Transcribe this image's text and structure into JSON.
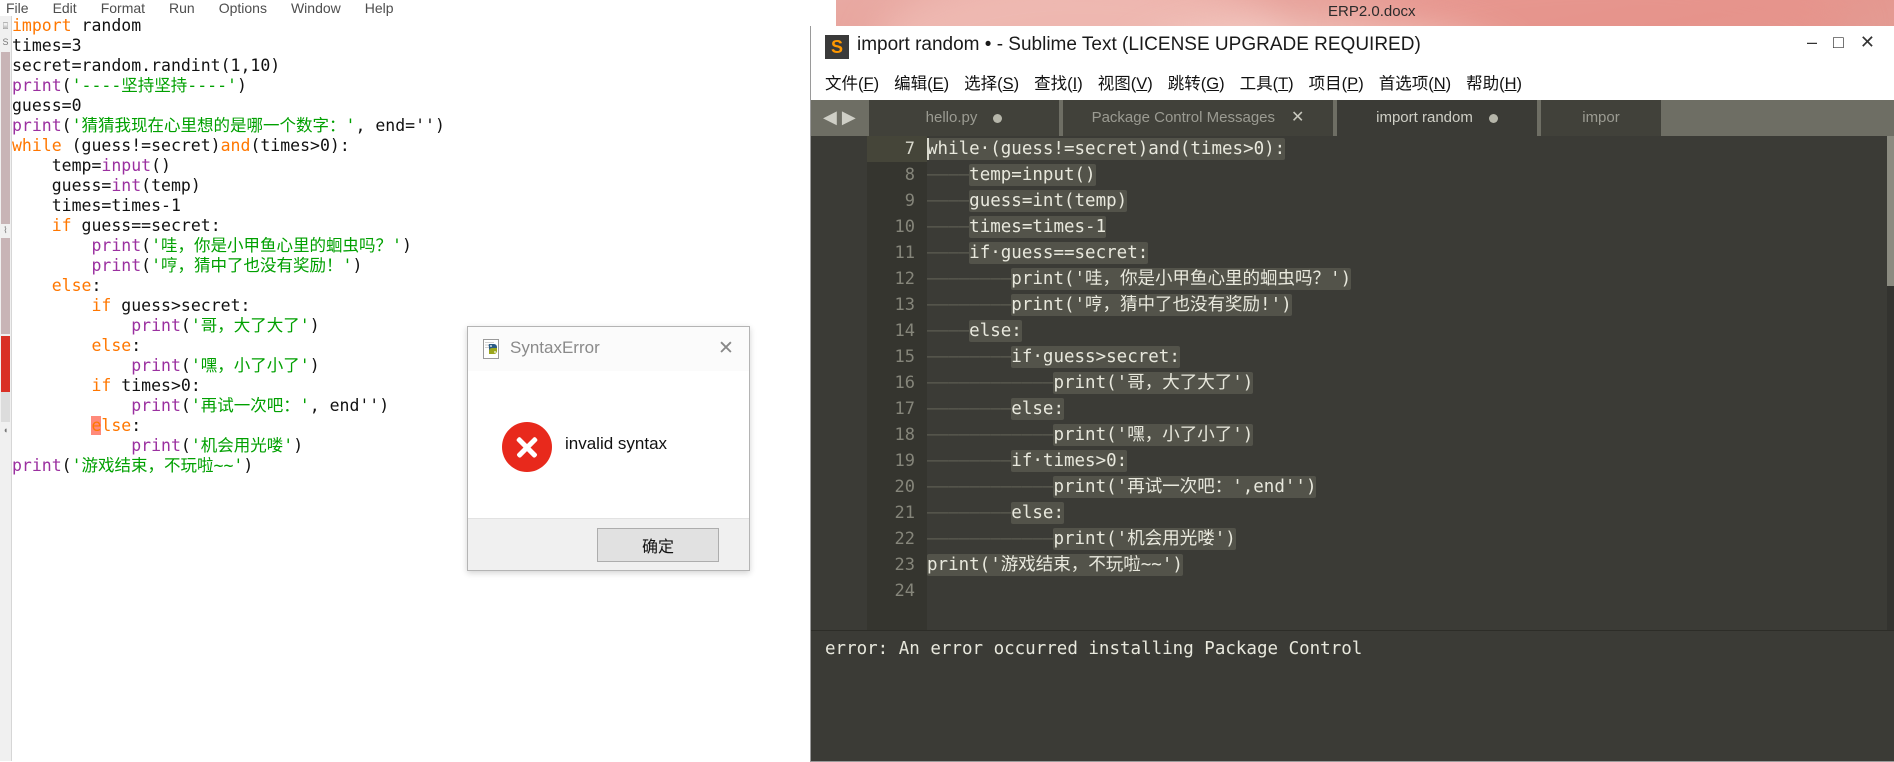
{
  "desktop": {
    "docx_label": "ERP2.0.docx"
  },
  "idle": {
    "window_name": "Python IDLE editor",
    "menubar": [
      "File",
      "Edit",
      "Format",
      "Run",
      "Options",
      "Window",
      "Help"
    ],
    "code_lines": [
      [
        {
          "t": "import ",
          "c": "kw"
        },
        {
          "t": "random",
          "c": ""
        }
      ],
      [
        {
          "t": "times=3",
          "c": ""
        }
      ],
      [
        {
          "t": "secret=random.randint(1,10)",
          "c": ""
        }
      ],
      [
        {
          "t": "print",
          "c": "fn"
        },
        {
          "t": "(",
          "c": ""
        },
        {
          "t": "'----坚持坚持----'",
          "c": "str"
        },
        {
          "t": ")",
          "c": ""
        }
      ],
      [
        {
          "t": "guess=0",
          "c": ""
        }
      ],
      [
        {
          "t": "print",
          "c": "fn"
        },
        {
          "t": "(",
          "c": ""
        },
        {
          "t": "'猜猜我现在心里想的是哪一个数字：'",
          "c": "str"
        },
        {
          "t": ", end='')",
          "c": ""
        }
      ],
      [
        {
          "t": "while",
          "c": "kw"
        },
        {
          "t": " (guess!=secret)",
          "c": ""
        },
        {
          "t": "and",
          "c": "kw"
        },
        {
          "t": "(times>0):",
          "c": ""
        }
      ],
      [
        {
          "t": "    temp=",
          "c": ""
        },
        {
          "t": "input",
          "c": "bi"
        },
        {
          "t": "()",
          "c": ""
        }
      ],
      [
        {
          "t": "    guess=",
          "c": ""
        },
        {
          "t": "int",
          "c": "bi"
        },
        {
          "t": "(temp)",
          "c": ""
        }
      ],
      [
        {
          "t": "    times=times-1",
          "c": ""
        }
      ],
      [
        {
          "t": "    ",
          "c": ""
        },
        {
          "t": "if",
          "c": "kw"
        },
        {
          "t": " guess==secret:",
          "c": ""
        }
      ],
      [
        {
          "t": "        ",
          "c": ""
        },
        {
          "t": "print",
          "c": "fn"
        },
        {
          "t": "(",
          "c": ""
        },
        {
          "t": "'哇，你是小甲鱼心里的蛔虫吗？'",
          "c": "str"
        },
        {
          "t": ")",
          "c": ""
        }
      ],
      [
        {
          "t": "        ",
          "c": ""
        },
        {
          "t": "print",
          "c": "fn"
        },
        {
          "t": "(",
          "c": ""
        },
        {
          "t": "'哼，猜中了也没有奖励！'",
          "c": "str"
        },
        {
          "t": ")",
          "c": ""
        }
      ],
      [
        {
          "t": "    ",
          "c": ""
        },
        {
          "t": "else",
          "c": "kw"
        },
        {
          "t": ":",
          "c": ""
        }
      ],
      [
        {
          "t": "        ",
          "c": ""
        },
        {
          "t": "if",
          "c": "kw"
        },
        {
          "t": " guess>secret:",
          "c": ""
        }
      ],
      [
        {
          "t": "            ",
          "c": ""
        },
        {
          "t": "print",
          "c": "fn"
        },
        {
          "t": "(",
          "c": ""
        },
        {
          "t": "'哥，大了大了'",
          "c": "str"
        },
        {
          "t": ")",
          "c": ""
        }
      ],
      [
        {
          "t": "        ",
          "c": ""
        },
        {
          "t": "else",
          "c": "kw"
        },
        {
          "t": ":",
          "c": ""
        }
      ],
      [
        {
          "t": "            ",
          "c": ""
        },
        {
          "t": "print",
          "c": "fn"
        },
        {
          "t": "(",
          "c": ""
        },
        {
          "t": "'嘿，小了小了'",
          "c": "str"
        },
        {
          "t": ")",
          "c": ""
        }
      ],
      [
        {
          "t": "        ",
          "c": ""
        },
        {
          "t": "if",
          "c": "kw"
        },
        {
          "t": " times>0:",
          "c": ""
        }
      ],
      [
        {
          "t": "            ",
          "c": ""
        },
        {
          "t": "print",
          "c": "fn"
        },
        {
          "t": "(",
          "c": ""
        },
        {
          "t": "'再试一次吧：'",
          "c": "str"
        },
        {
          "t": ", end'')",
          "c": ""
        }
      ],
      [
        {
          "t": "        ",
          "c": ""
        },
        {
          "t": "e",
          "c": "err"
        },
        {
          "t": "lse",
          "c": "kw"
        },
        {
          "t": ":",
          "c": ""
        }
      ],
      [
        {
          "t": "            ",
          "c": ""
        },
        {
          "t": "print",
          "c": "fn"
        },
        {
          "t": "(",
          "c": ""
        },
        {
          "t": "'机会用光喽'",
          "c": "str"
        },
        {
          "t": ")",
          "c": ""
        }
      ],
      [
        {
          "t": "print",
          "c": "fn"
        },
        {
          "t": "(",
          "c": ""
        },
        {
          "t": "'游戏结束，不玩啦~~'",
          "c": "str"
        },
        {
          "t": ")",
          "c": ""
        }
      ]
    ]
  },
  "dialog": {
    "title": "SyntaxError",
    "icon": "python-file-icon",
    "close_label": "✕",
    "message": "invalid syntax",
    "error_icon": "error-circle-x-icon",
    "ok_label": "确定"
  },
  "sublime": {
    "title": "import random • - Sublime Text (LICENSE UPGRADE REQUIRED)",
    "logo_glyph": "S",
    "window_buttons": [
      "‒",
      "□",
      "✕"
    ],
    "menu": [
      {
        "label": "文件",
        "accel": "F"
      },
      {
        "label": "编辑",
        "accel": "E"
      },
      {
        "label": "选择",
        "accel": "S"
      },
      {
        "label": "查找",
        "accel": "I"
      },
      {
        "label": "视图",
        "accel": "V"
      },
      {
        "label": "跳转",
        "accel": "G"
      },
      {
        "label": "工具",
        "accel": "T"
      },
      {
        "label": "项目",
        "accel": "P"
      },
      {
        "label": "首选项",
        "accel": "N"
      },
      {
        "label": "帮助",
        "accel": "H"
      }
    ],
    "tabs": [
      {
        "label": "hello.py",
        "state": "dirty",
        "active": false
      },
      {
        "label": "Package Control Messages",
        "state": "closable",
        "active": false
      },
      {
        "label": "import random",
        "state": "dirty",
        "active": true
      },
      {
        "label": "impor",
        "state": "plain",
        "active": false
      }
    ],
    "nav_arrows": "◀ ▶",
    "editor_lines": [
      {
        "num": "7",
        "current": true,
        "caret": true,
        "indent": 0,
        "text": "while·(guess!=secret)and(times>0):"
      },
      {
        "num": "8",
        "current": false,
        "caret": false,
        "indent": 1,
        "text": "temp=input()"
      },
      {
        "num": "9",
        "current": false,
        "caret": false,
        "indent": 1,
        "text": "guess=int(temp)"
      },
      {
        "num": "10",
        "current": false,
        "caret": false,
        "indent": 1,
        "text": "times=times-1"
      },
      {
        "num": "11",
        "current": false,
        "caret": false,
        "indent": 1,
        "text": "if·guess==secret:"
      },
      {
        "num": "12",
        "current": false,
        "caret": false,
        "indent": 2,
        "text": "print('哇，你是小甲鱼心里的蛔虫吗？')"
      },
      {
        "num": "13",
        "current": false,
        "caret": false,
        "indent": 2,
        "text": "print('哼，猜中了也没有奖励!')"
      },
      {
        "num": "14",
        "current": false,
        "caret": false,
        "indent": 1,
        "text": "else:"
      },
      {
        "num": "15",
        "current": false,
        "caret": false,
        "indent": 2,
        "text": "if·guess>secret:"
      },
      {
        "num": "16",
        "current": false,
        "caret": false,
        "indent": 3,
        "text": "print('哥，大了大了')"
      },
      {
        "num": "17",
        "current": false,
        "caret": false,
        "indent": 2,
        "text": "else:"
      },
      {
        "num": "18",
        "current": false,
        "caret": false,
        "indent": 3,
        "text": "print('嘿，小了小了')"
      },
      {
        "num": "19",
        "current": false,
        "caret": false,
        "indent": 2,
        "text": "if·times>0:"
      },
      {
        "num": "20",
        "current": false,
        "caret": false,
        "indent": 3,
        "text": "print('再试一次吧：',end'')"
      },
      {
        "num": "21",
        "current": false,
        "caret": false,
        "indent": 2,
        "text": "else:"
      },
      {
        "num": "22",
        "current": false,
        "caret": false,
        "indent": 3,
        "text": "print('机会用光喽')"
      },
      {
        "num": "23",
        "current": false,
        "caret": false,
        "indent": 0,
        "text": "print('游戏结束，不玩啦~~')"
      },
      {
        "num": "24",
        "current": false,
        "caret": false,
        "indent": 0,
        "text": ""
      }
    ],
    "console_text": "error: An error occurred installing Package Control"
  }
}
